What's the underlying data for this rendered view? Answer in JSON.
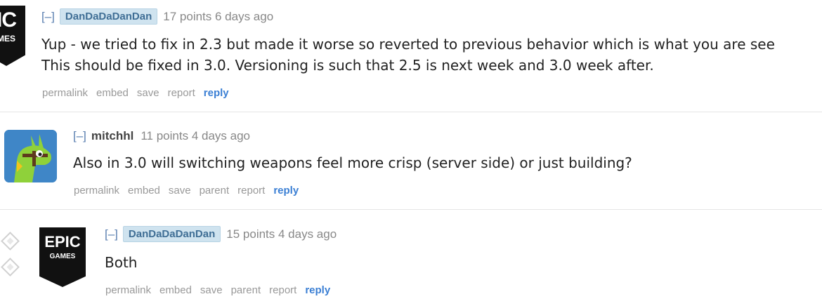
{
  "comments": [
    {
      "collapse": "[–]",
      "author": "DanDaDaDanDan",
      "author_is_flair": true,
      "score_time": "17 points 6 days ago",
      "body": [
        "Yup - we tried to fix in 2.3 but made it worse so reverted to previous behavior which is what you are see",
        "This should be fixed in 3.0. Versioning is such that 2.5 is next week and 3.0 week after."
      ],
      "avatar": {
        "top": "IC",
        "bottom": "MES"
      },
      "actions": [
        "permalink",
        "embed",
        "save",
        "report",
        "reply"
      ]
    },
    {
      "collapse": "[–]",
      "author": "mitchhl",
      "author_is_flair": false,
      "score_time": "11 points 4 days ago",
      "body": [
        "Also in 3.0 will switching weapons feel more crisp (server side) or just building?"
      ],
      "actions": [
        "permalink",
        "embed",
        "save",
        "parent",
        "report",
        "reply"
      ]
    },
    {
      "collapse": "[–]",
      "author": "DanDaDaDanDan",
      "author_is_flair": true,
      "score_time": "15 points 4 days ago",
      "body": [
        "Both"
      ],
      "avatar": {
        "top": "EPIC",
        "bottom": "GAMES"
      },
      "actions": [
        "permalink",
        "embed",
        "save",
        "parent",
        "report",
        "reply"
      ]
    }
  ],
  "colors": {
    "flair_bg": "#cfe3ef",
    "flair_text": "#3f6e95",
    "reply_link": "#3b7fd4",
    "action_gray": "#999999",
    "llama_bg": "#3f86c7",
    "llama_green": "#8fd13a"
  }
}
